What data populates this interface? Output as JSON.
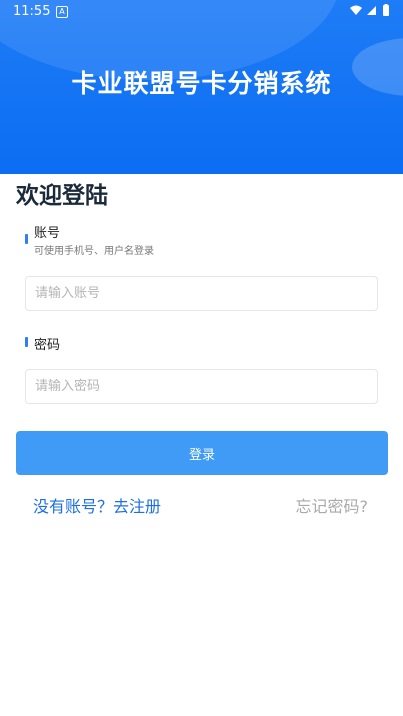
{
  "status_bar": {
    "time": "11:55",
    "notification_icon_letter": "A"
  },
  "header": {
    "title": "卡业联盟号卡分销系统"
  },
  "welcome_text": "欢迎登陆",
  "account": {
    "label": "账号",
    "hint": "可使用手机号、用户名登录",
    "placeholder": "请输入账号",
    "value": ""
  },
  "password": {
    "label": "密码",
    "placeholder": "请输入密码",
    "value": ""
  },
  "login_button": "登录",
  "register_link": "没有账号？去注册",
  "forgot_link": "忘记密码?",
  "colors": {
    "primary": "#0b6df2",
    "button": "#3f9bf6",
    "link": "#1c6fe6",
    "muted_link": "#aaaaaa"
  }
}
